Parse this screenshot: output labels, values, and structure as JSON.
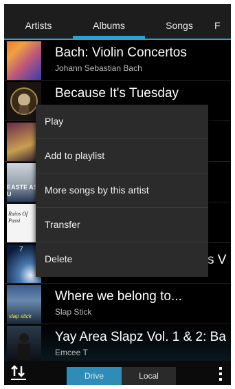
{
  "tabs": [
    {
      "label": "Artists"
    },
    {
      "label": "Albums",
      "active": true
    },
    {
      "label": "Songs"
    },
    {
      "label": "F"
    }
  ],
  "albums": [
    {
      "title": "Bach: Violin Concertos",
      "artist": "Johann Sebastian Bach"
    },
    {
      "title": "Because It's Tuesday",
      "artist": ""
    },
    {
      "title": "",
      "artist": ""
    },
    {
      "title": "",
      "artist": ""
    },
    {
      "title": "",
      "artist": ""
    },
    {
      "title": "",
      "artist": ""
    },
    {
      "title": "Where we belong to...",
      "artist": "Slap Stick"
    },
    {
      "title": "Yay Area Slapz Vol. 1 & 2: Ba",
      "artist": "Emcee T"
    }
  ],
  "cover_texts": {
    "easter": "EASTE AS U",
    "rains": "Rains Of Passi",
    "slapstick": "slap stick",
    "num7": "7"
  },
  "context_menu": {
    "items": [
      "Play",
      "Add to playlist",
      "More songs by this artist",
      "Transfer",
      "Delete"
    ]
  },
  "obscured_row_text": "s V",
  "bottom_bar": {
    "drive_label": "Drive",
    "local_label": "Local",
    "active": "Drive"
  },
  "colors": {
    "accent": "#2aa3d8",
    "menu_bg": "#2b2b2b",
    "selected_segment": "#2e8cb8"
  },
  "icons": {
    "sort": "sort-arrows-icon",
    "overflow": "overflow-menu-icon"
  }
}
